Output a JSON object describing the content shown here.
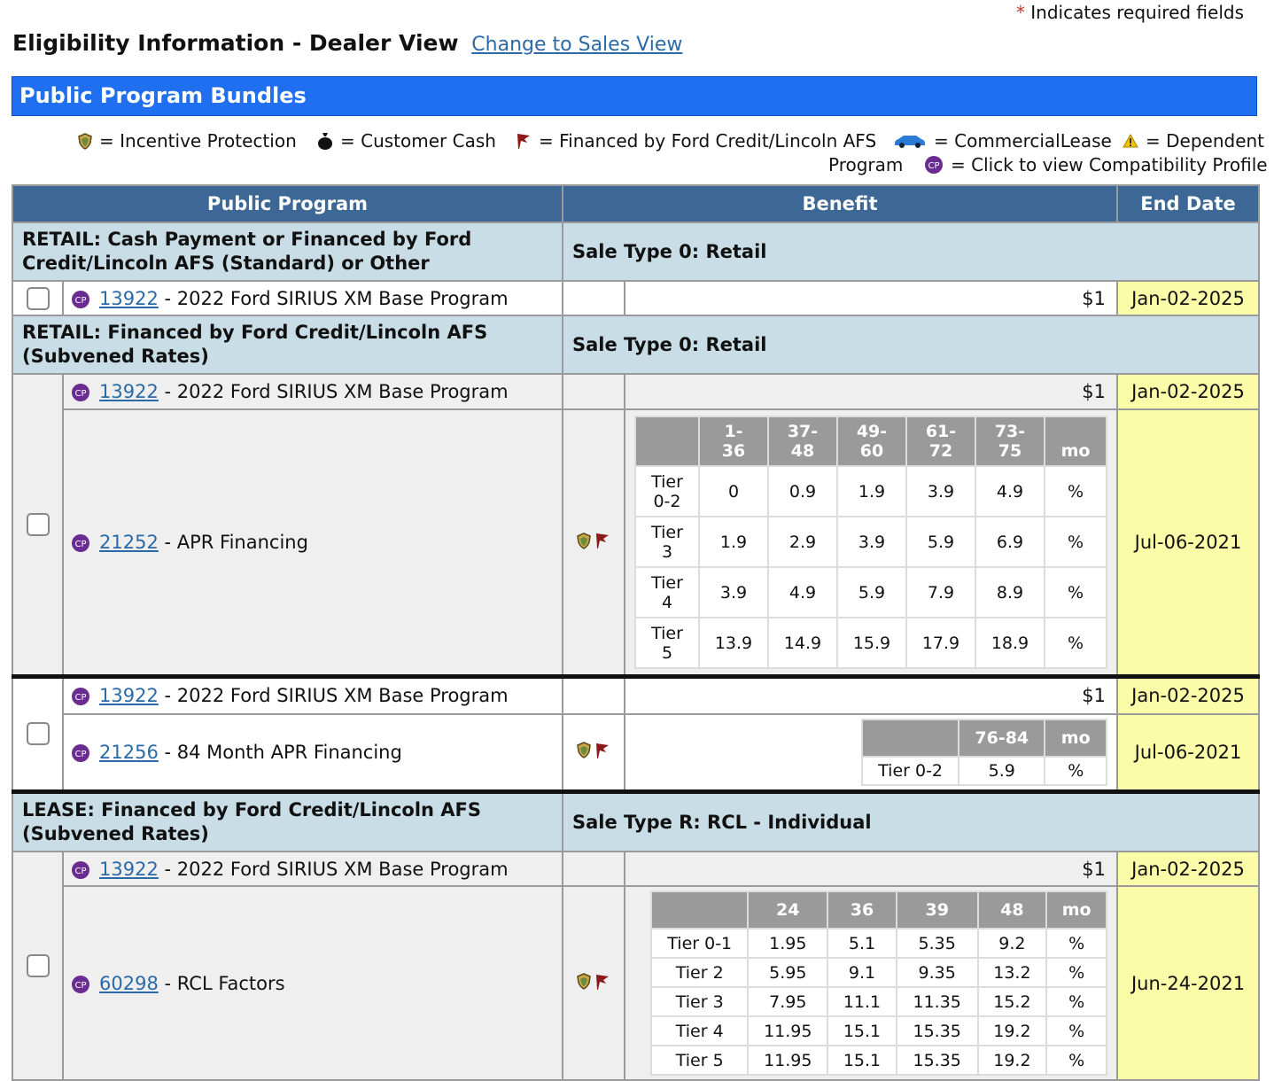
{
  "required_note": {
    "star": "*",
    "text": "Indicates required fields"
  },
  "title": "Eligibility Information - Dealer View",
  "switch_link": "Change to Sales View",
  "banner": "Public Program Bundles",
  "legend": {
    "incentive_protection": "= Incentive Protection",
    "customer_cash": "= Customer Cash",
    "financed": "= Financed by Ford Credit/Lincoln AFS",
    "commercial_lease": "= CommercialLease",
    "commercial_lease_2": "Program",
    "dependent": "= Dependent",
    "compat": "= Click to view Compatibility Profile",
    "cp_badge": "CP"
  },
  "columns": {
    "program": "Public Program",
    "benefit": "Benefit",
    "end_date": "End Date"
  },
  "sections": [
    {
      "title": "RETAIL: Cash Payment or Financed by Ford Credit/Lincoln AFS (Standard) or Other",
      "sale_type": "Sale Type 0: Retail"
    },
    {
      "title": "RETAIL: Financed by Ford Credit/Lincoln AFS (Subvened Rates)",
      "sale_type": "Sale Type 0: Retail"
    },
    {
      "title": "LEASE: Financed by Ford Credit/Lincoln AFS (Subvened Rates)",
      "sale_type": "Sale Type R: RCL - Individual"
    }
  ],
  "base_program": {
    "id": "13922",
    "name": " - 2022 Ford SIRIUS XM Base Program",
    "amount": "$1",
    "end": "Jan-02-2025"
  },
  "apr": {
    "id": "21252",
    "name": " - APR Financing",
    "end": "Jul-06-2021",
    "headers": [
      [
        "1-",
        "36"
      ],
      [
        "37-",
        "48"
      ],
      [
        "49-",
        "60"
      ],
      [
        "61-",
        "72"
      ],
      [
        "73-",
        "75"
      ],
      [
        "",
        "mo"
      ]
    ],
    "rows": [
      {
        "tier": [
          "Tier",
          "0-2"
        ],
        "vals": [
          "0",
          "0.9",
          "1.9",
          "3.9",
          "4.9",
          "%"
        ]
      },
      {
        "tier": [
          "Tier",
          "3"
        ],
        "vals": [
          "1.9",
          "2.9",
          "3.9",
          "5.9",
          "6.9",
          "%"
        ]
      },
      {
        "tier": [
          "Tier",
          "4"
        ],
        "vals": [
          "3.9",
          "4.9",
          "5.9",
          "7.9",
          "8.9",
          "%"
        ]
      },
      {
        "tier": [
          "Tier",
          "5"
        ],
        "vals": [
          "13.9",
          "14.9",
          "15.9",
          "17.9",
          "18.9",
          "%"
        ]
      }
    ]
  },
  "apr84": {
    "id": "21256",
    "name": " - 84 Month APR Financing",
    "end": "Jul-06-2021",
    "headers": [
      "76-84",
      "mo"
    ],
    "row": {
      "tier": "Tier 0-2",
      "vals": [
        "5.9",
        "%"
      ]
    }
  },
  "rcl": {
    "id": "60298",
    "name": " - RCL Factors",
    "end": "Jun-24-2021",
    "headers": [
      "24",
      "36",
      "39",
      "48",
      "mo"
    ],
    "rows": [
      {
        "tier": "Tier 0-1",
        "vals": [
          "1.95",
          "5.1",
          "5.35",
          "9.2",
          "%"
        ]
      },
      {
        "tier": "Tier 2",
        "vals": [
          "5.95",
          "9.1",
          "9.35",
          "13.2",
          "%"
        ]
      },
      {
        "tier": "Tier 3",
        "vals": [
          "7.95",
          "11.1",
          "11.35",
          "15.2",
          "%"
        ]
      },
      {
        "tier": "Tier 4",
        "vals": [
          "11.95",
          "15.1",
          "15.35",
          "19.2",
          "%"
        ]
      },
      {
        "tier": "Tier 5",
        "vals": [
          "11.95",
          "15.1",
          "15.35",
          "19.2",
          "%"
        ]
      }
    ]
  },
  "colors": {
    "banner": "#1f6ff0",
    "header": "#3d6896",
    "group": "#c9dde6",
    "end_date": "#fbfca8",
    "link": "#2a6aa6"
  }
}
